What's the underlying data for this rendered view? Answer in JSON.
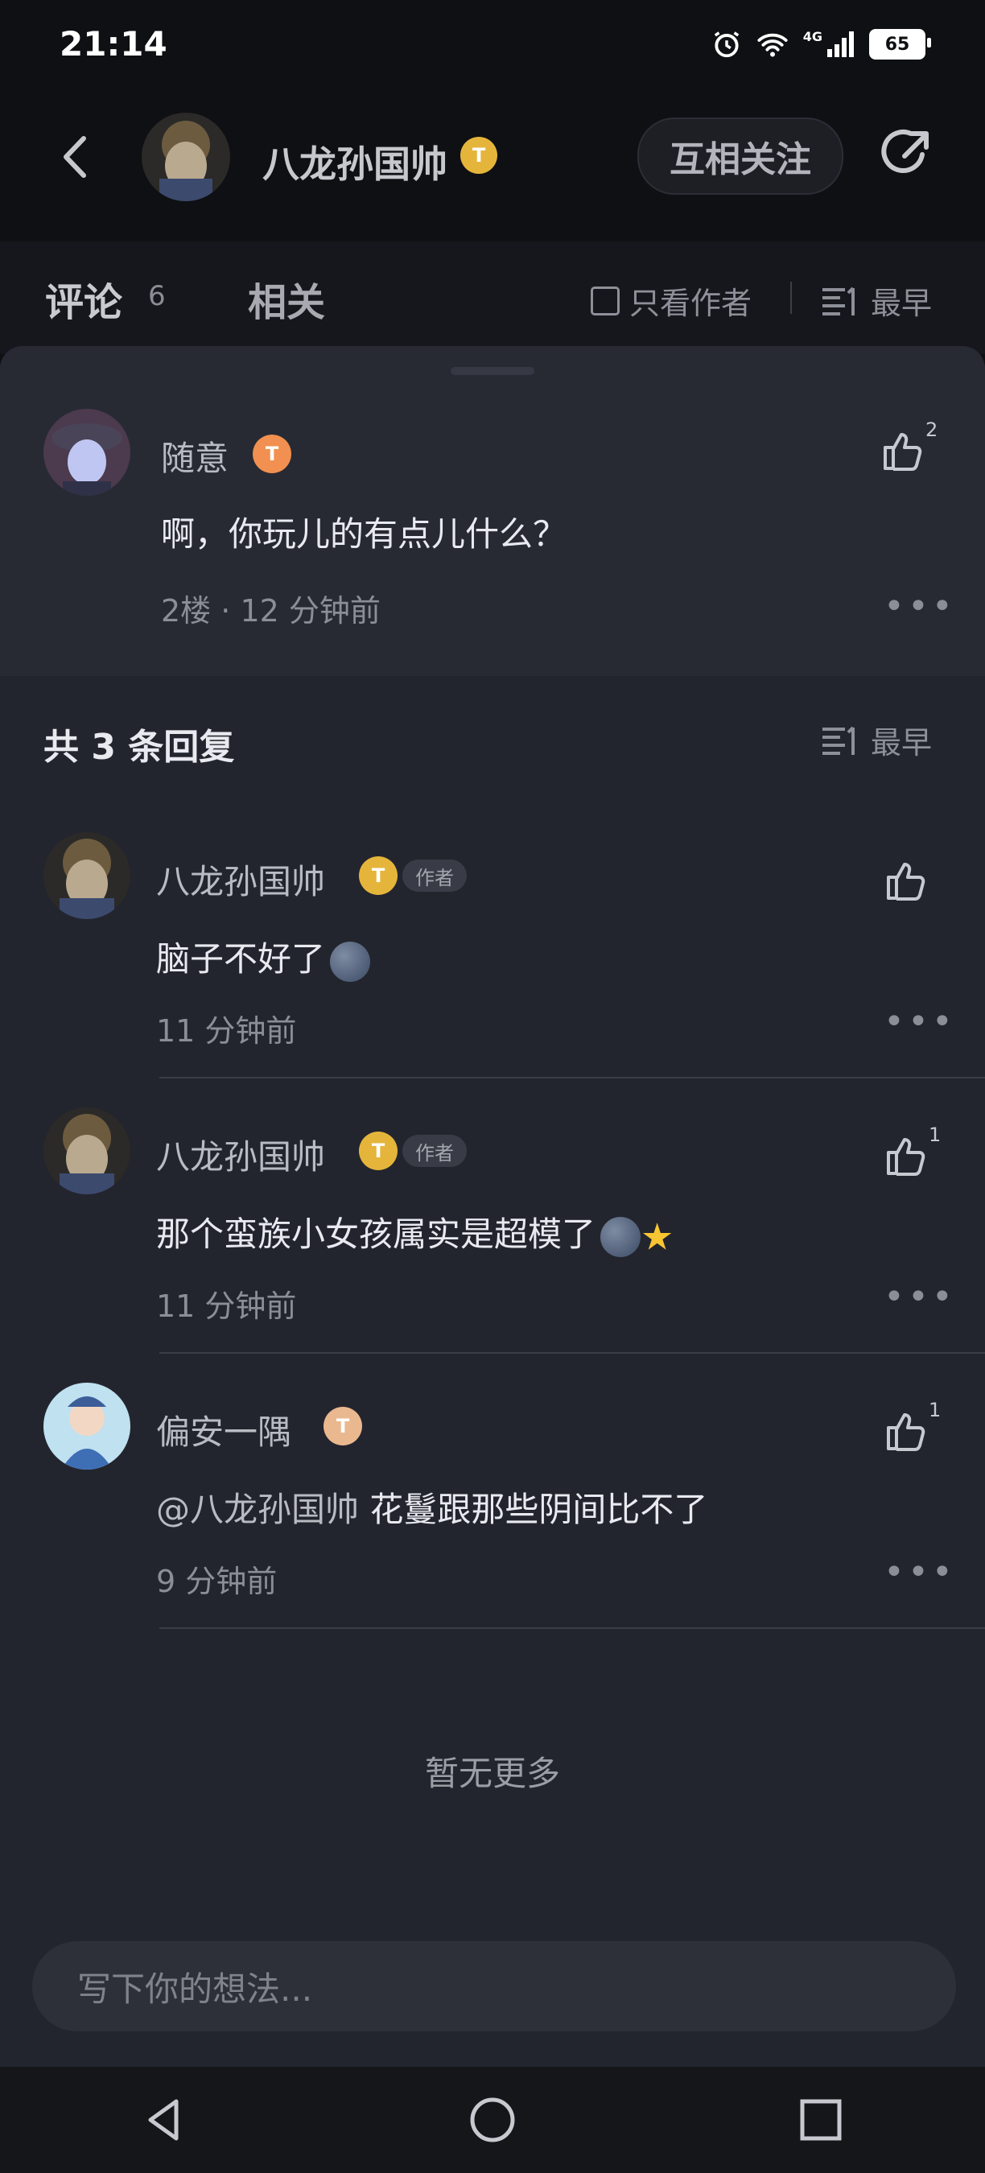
{
  "status_bar": {
    "time": "21:14",
    "network": "4G",
    "battery": "65"
  },
  "header": {
    "title": "八龙孙国帅",
    "vip_badge": "T",
    "follow_label": "互相关注"
  },
  "tabs": {
    "comments_label": "评论",
    "comments_count": "6",
    "related_label": "相关",
    "only_author_label": "只看作者",
    "sort_label": "最早"
  },
  "main_comment": {
    "user": "随意",
    "vip_badge": "T",
    "text": "啊，你玩儿的有点儿什么？",
    "floor": "2楼",
    "time": "12 分钟前",
    "likes": "2"
  },
  "replies": {
    "title": "共 3 条回复",
    "sort_label": "最早",
    "items": [
      {
        "user": "八龙孙国帅",
        "vip_badge": "T",
        "tag": "作者",
        "text": "脑子不好了",
        "emoji": "moon-face",
        "time": "11 分钟前",
        "likes": ""
      },
      {
        "user": "八龙孙国帅",
        "vip_badge": "T",
        "tag": "作者",
        "text": "那个蛮族小女孩属实是超模了",
        "emoji": "moon-face star",
        "time": "11 分钟前",
        "likes": "1"
      },
      {
        "user": "偏安一隅",
        "vip_badge": "T",
        "mention": "@八龙孙国帅",
        "text": "花鬘跟那些阴间比不了",
        "time": "9 分钟前",
        "likes": "1"
      }
    ]
  },
  "no_more": "暂无更多",
  "input": {
    "placeholder": "写下你的想法..."
  },
  "colors": {
    "background": "#23252e",
    "vip_gold": "#e5b53b",
    "vip_orange": "#f19050"
  }
}
